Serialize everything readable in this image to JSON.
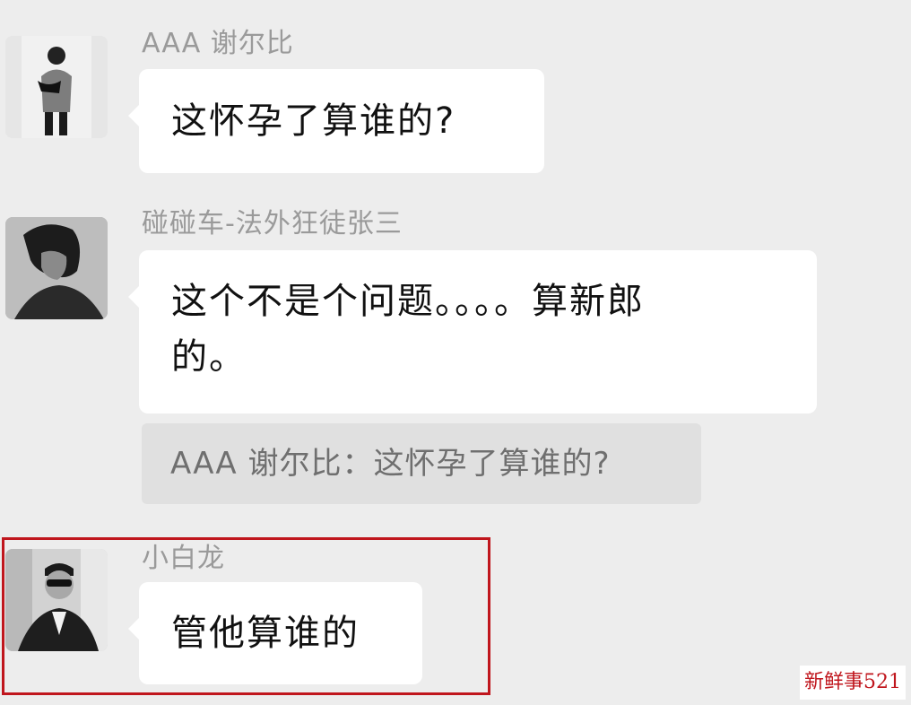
{
  "messages": [
    {
      "sender": "AAA 谢尔比",
      "text": "这怀孕了算谁的?"
    },
    {
      "sender": "碰碰车-法外狂徒张三",
      "text_line1": "这个不是个问题。。。。算新郎",
      "text_line2": "的。",
      "quote": "AAA 谢尔比：这怀孕了算谁的?"
    },
    {
      "sender": "小白龙",
      "text": "管他算谁的"
    }
  ],
  "watermark": "新鲜事521",
  "colors": {
    "background": "#ededed",
    "bubble": "#ffffff",
    "highlight_border": "#c0161d"
  },
  "icons": [
    "avatar-shelby",
    "avatar-zhangsan",
    "avatar-xiaobailong"
  ]
}
